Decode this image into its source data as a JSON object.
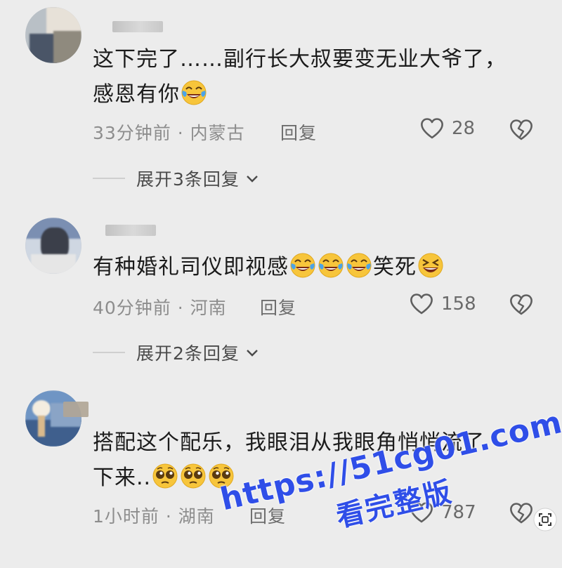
{
  "comments": [
    {
      "text_line1": "这下完了……副行长大叔要变无业大爷了，",
      "text_line2": "感恩有你",
      "time": "33分钟前",
      "separator": "·",
      "location": "内蒙古",
      "reply_label": "回复",
      "likes": "28",
      "expand_label": "展开3条回复"
    },
    {
      "text": "有种婚礼司仪即视感",
      "text_tail": "笑死",
      "time": "40分钟前",
      "separator": "·",
      "location": "河南",
      "reply_label": "回复",
      "likes": "158",
      "expand_label": "展开2条回复"
    },
    {
      "text_line1": "搭配这个配乐，我眼泪从我眼角悄悄流了",
      "text_line2": "下来..",
      "time": "1小时前",
      "separator": "·",
      "location": "湖南",
      "reply_label": "回复",
      "likes": "787"
    }
  ],
  "watermark": {
    "url": "https://51cg01.com",
    "label": "看完整版"
  },
  "colors": {
    "background": "#ececec",
    "watermark": "#2f4ee8",
    "emoji_face": "#f7c53b",
    "emoji_tear": "#4aa3e8"
  },
  "icons": [
    "heart-outline-icon",
    "broken-heart-icon",
    "chevron-down-icon",
    "scan-icon",
    "cry-laugh-emoji",
    "pleading-emoji",
    "grin-squint-emoji"
  ]
}
